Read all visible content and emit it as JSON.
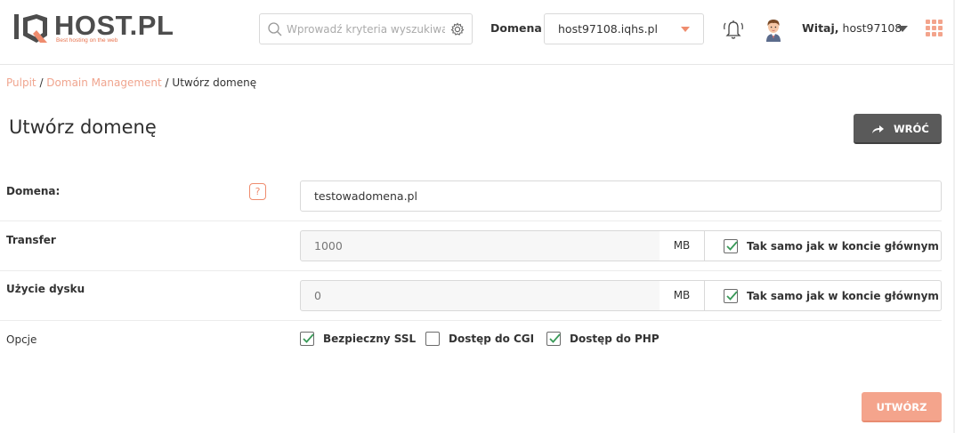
{
  "header": {
    "logo_text": "HOST.PL",
    "logo_tagline": "Best hosting on the web",
    "search_placeholder": "Wprowadź kryteria wyszukiwania",
    "domain_label": "Domena",
    "domain_selected": "host97108.iqhs.pl",
    "greeting_bold": "Witaj,",
    "greeting_user": "host97108",
    "brand_color": "#ef8c6e"
  },
  "breadcrumb": {
    "items": [
      "Pulpit",
      "Domain Management",
      "Utwórz domenę"
    ],
    "separator": " / "
  },
  "page": {
    "title": "Utwórz domenę",
    "back_label": "WRÓĆ"
  },
  "form": {
    "domain": {
      "label": "Domena:",
      "value": "testowadomena.pl",
      "help_icon": "?"
    },
    "transfer": {
      "label": "Transfer",
      "value": "1000",
      "unit": "MB",
      "same_label": "Tak samo jak w koncie głównym",
      "same_checked": true
    },
    "disk": {
      "label": "Użycie dysku",
      "value": "0",
      "unit": "MB",
      "same_label": "Tak samo jak w koncie głównym",
      "same_checked": true
    },
    "options": {
      "label": "Opcje",
      "items": [
        {
          "label": "Bezpieczny SSL",
          "checked": true
        },
        {
          "label": "Dostęp do CGI",
          "checked": false
        },
        {
          "label": "Dostęp do PHP",
          "checked": true
        }
      ]
    },
    "submit_label": "UTWÓRZ"
  }
}
